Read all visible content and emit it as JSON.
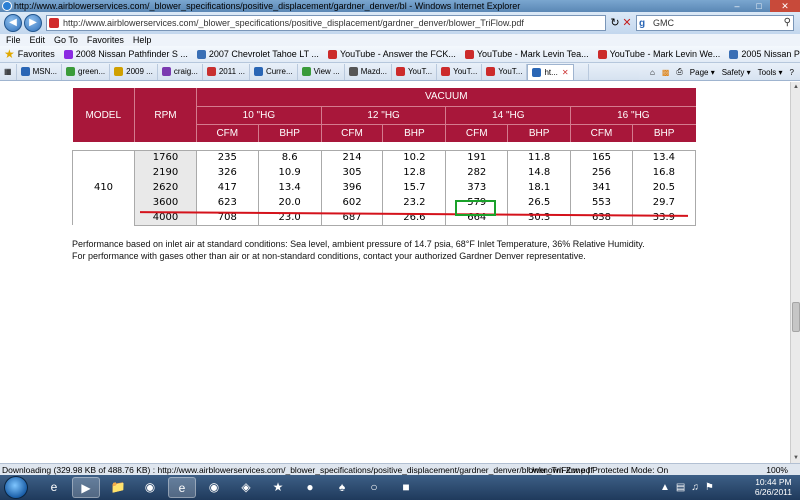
{
  "window": {
    "title": "http://www.airblowerservices.com/_blower_specifications/positive_displacement/gardner_denver/bl - Windows Internet Explorer"
  },
  "address": {
    "url": "http://www.airblowerservices.com/_blower_specifications/positive_displacement/gardner_denver/blower_TriFlow.pdf",
    "search_text": "GMC"
  },
  "menu": [
    "File",
    "Edit",
    "Go To",
    "Favorites",
    "Help"
  ],
  "favorites": {
    "label": "Favorites",
    "items": [
      {
        "label": "2008 Nissan Pathfinder S ...",
        "color": "#8a2be2"
      },
      {
        "label": "2007 Chevrolet Tahoe LT ...",
        "color": "#3a6fb5"
      },
      {
        "label": "YouTube - Answer the FCK...",
        "color": "#cc2b2b"
      },
      {
        "label": "YouTube - Mark Levin Tea...",
        "color": "#cc2b2b"
      },
      {
        "label": "YouTube - Mark Levin We...",
        "color": "#cc2b2b"
      },
      {
        "label": "2005 Nissan Pathfinder",
        "color": "#3a6fb5"
      }
    ]
  },
  "tabs": [
    {
      "label": "MSN...",
      "color": "#2a66b5"
    },
    {
      "label": "green...",
      "color": "#3a9b3a"
    },
    {
      "label": "2009 ...",
      "color": "#d0a000"
    },
    {
      "label": "craig...",
      "color": "#7a3ab0"
    },
    {
      "label": "2011 ...",
      "color": "#c83030"
    },
    {
      "label": "Curre...",
      "color": "#2a66b5"
    },
    {
      "label": "View ...",
      "color": "#3a9b3a"
    },
    {
      "label": "Mazd...",
      "color": "#555555"
    },
    {
      "label": "YouT...",
      "color": "#cc2b2b"
    },
    {
      "label": "YouT...",
      "color": "#cc2b2b"
    },
    {
      "label": "YouT...",
      "color": "#cc2b2b"
    },
    {
      "label": "ht...",
      "color": "#2a66b5"
    }
  ],
  "commandbar": [
    "Page ▾",
    "Safety ▾",
    "Tools ▾",
    "?"
  ],
  "table": {
    "model_header": "MODEL",
    "rpm_header": "RPM",
    "vacuum_header": "VACUUM",
    "vacuum_levels": [
      "10 \"HG",
      "12 \"HG",
      "14 \"HG",
      "16 \"HG"
    ],
    "sub_headers": [
      "CFM",
      "BHP"
    ],
    "model": "410",
    "rows": [
      {
        "rpm": "1760",
        "vals": [
          "235",
          "8.6",
          "214",
          "10.2",
          "191",
          "11.8",
          "165",
          "13.4"
        ]
      },
      {
        "rpm": "2190",
        "vals": [
          "326",
          "10.9",
          "305",
          "12.8",
          "282",
          "14.8",
          "256",
          "16.8"
        ]
      },
      {
        "rpm": "2620",
        "vals": [
          "417",
          "13.4",
          "396",
          "15.7",
          "373",
          "18.1",
          "341",
          "20.5"
        ]
      },
      {
        "rpm": "3600",
        "vals": [
          "623",
          "20.0",
          "602",
          "23.2",
          "579",
          "26.5",
          "553",
          "29.7"
        ]
      },
      {
        "rpm": "4000",
        "vals": [
          "708",
          "23.0",
          "687",
          "26.6",
          "664",
          "30.3",
          "638",
          "33.9"
        ]
      }
    ]
  },
  "notes": {
    "line1": "Performance based on inlet air at standard conditions: Sea level, ambient pressure of 14.7 psia, 68°F Inlet Temperature, 36% Relative Humidity.",
    "line2": "For performance with gases other than air or at non-standard conditions, contact your authorized Gardner Denver representative."
  },
  "status": {
    "text": "Downloading (329.98 KB of 488.76 KB) : http://www.airblowerservices.com/_blower_specifications/positive_displacement/gardner_denver/blower_TriFlow.pdf",
    "zone": "Unknown Zone | Protected Mode: On",
    "zoom": "100%"
  },
  "clock": {
    "time": "10:44 PM",
    "date": "6/26/2011"
  }
}
